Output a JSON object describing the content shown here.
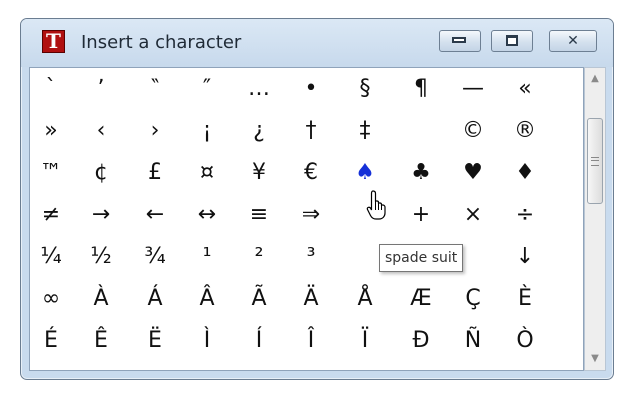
{
  "window": {
    "title": "Insert a character",
    "app_icon_letter": "T"
  },
  "controls": {
    "minimize": "minimize-icon",
    "maximize": "maximize-icon",
    "close": "close-icon",
    "close_glyph": "✕"
  },
  "rows": [
    [
      "`",
      "ʼ",
      "‶",
      "″",
      "…",
      "•",
      "§",
      "¶",
      "—",
      "«"
    ],
    [
      "»",
      "‹",
      "›",
      "¡",
      "¿",
      "†",
      "‡",
      "",
      "©",
      "®"
    ],
    [
      "™",
      "¢",
      "£",
      "¤",
      "¥",
      "€",
      "♠",
      "♣",
      "♥",
      "♦"
    ],
    [
      "≠",
      "→",
      "←",
      "↔",
      "≡",
      "⇒",
      "",
      "+",
      "×",
      "÷"
    ],
    [
      "¼",
      "½",
      "¾",
      "¹",
      "²",
      "³",
      "",
      "",
      "",
      "↓"
    ],
    [
      "∞",
      "À",
      "Á",
      "Â",
      "Ã",
      "Ä",
      "Å",
      "Æ",
      "Ç",
      "È"
    ],
    [
      "É",
      "Ê",
      "Ë",
      "Ì",
      "Í",
      "Î",
      "Ï",
      "Đ",
      "Ñ",
      "Ò"
    ]
  ],
  "selected": {
    "row": 2,
    "col": 6,
    "color": "#1530d8"
  },
  "tooltip": {
    "text": "spade suit"
  },
  "scrollbar": {
    "up_glyph": "▲",
    "down_glyph": "▼"
  },
  "colors": {
    "titlebar": "#c9dbee",
    "border": "#6b7d91",
    "accent": "#b01010"
  }
}
